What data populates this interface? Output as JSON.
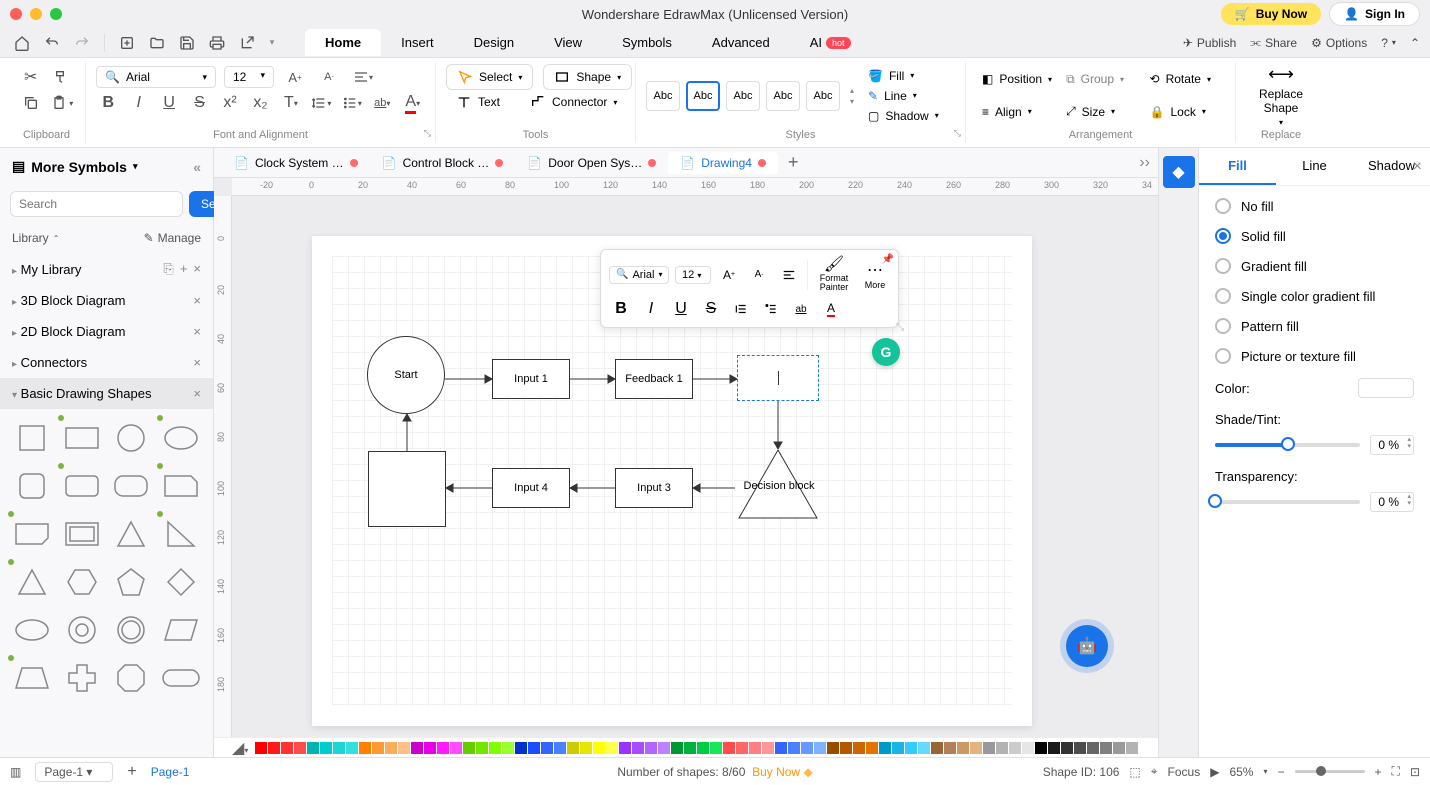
{
  "window": {
    "title": "Wondershare EdrawMax (Unlicensed Version)"
  },
  "titlebar": {
    "buy_now": "Buy Now",
    "sign_in": "Sign In"
  },
  "menu": {
    "tabs": [
      "Home",
      "Insert",
      "Design",
      "View",
      "Symbols",
      "Advanced"
    ],
    "active": 0,
    "ai_label": "AI",
    "hot_label": "hot",
    "publish": "Publish",
    "share": "Share",
    "options": "Options"
  },
  "ribbon": {
    "clipboard_label": "Clipboard",
    "font_label": "Font and Alignment",
    "tools_label": "Tools",
    "styles_label": "Styles",
    "arrangement_label": "Arrangement",
    "replace_label": "Replace",
    "font_name": "Arial",
    "font_size": "12",
    "select_label": "Select",
    "shape_label": "Shape",
    "text_label": "Text",
    "connector_label": "Connector",
    "style_samples": [
      "Abc",
      "Abc",
      "Abc",
      "Abc",
      "Abc"
    ],
    "fill": "Fill",
    "line": "Line",
    "shadow": "Shadow",
    "position": "Position",
    "group": "Group",
    "rotate": "Rotate",
    "align": "Align",
    "size": "Size",
    "lock": "Lock",
    "replace_shape": "Replace\nShape",
    "replace": "Replace"
  },
  "sidebar": {
    "title": "More Symbols",
    "search_placeholder": "Search",
    "search_btn": "Search",
    "library_label": "Library",
    "manage_label": "Manage",
    "categories": [
      {
        "name": "My Library",
        "buttons": true
      },
      {
        "name": "3D Block Diagram",
        "close": true
      },
      {
        "name": "2D Block Diagram",
        "close": true
      },
      {
        "name": "Connectors",
        "close": true
      },
      {
        "name": "Basic Drawing Shapes",
        "close": true,
        "active": true
      }
    ]
  },
  "docs": {
    "tabs": [
      {
        "name": "Clock System …",
        "unsaved": true
      },
      {
        "name": "Control Block …",
        "unsaved": true
      },
      {
        "name": "Door Open Sys…",
        "unsaved": true
      },
      {
        "name": "Drawing4",
        "unsaved": true,
        "active": true
      }
    ]
  },
  "ruler": {
    "h": [
      "-20",
      "0",
      "20",
      "40",
      "60",
      "80",
      "100",
      "120",
      "140",
      "160",
      "180",
      "200",
      "220",
      "240",
      "260",
      "280",
      "300",
      "320",
      "34"
    ],
    "v": [
      "0",
      "20",
      "40",
      "60",
      "80",
      "100",
      "120",
      "140",
      "160",
      "180"
    ]
  },
  "canvas": {
    "start": "Start",
    "input1": "Input 1",
    "feedback1": "Feedback 1",
    "input4": "Input 4",
    "input3": "Input 3",
    "decision": "Decision block"
  },
  "mini_toolbar": {
    "font": "Arial",
    "size": "12",
    "format_painter": "Format\nPainter",
    "more": "More"
  },
  "right_panel": {
    "tabs": [
      "Fill",
      "Line",
      "Shadow"
    ],
    "active": 0,
    "options": [
      "No fill",
      "Solid fill",
      "Gradient fill",
      "Single color gradient fill",
      "Pattern fill",
      "Picture or texture fill"
    ],
    "selected": 1,
    "color_label": "Color:",
    "shade_label": "Shade/Tint:",
    "transparency_label": "Transparency:",
    "shade_val": "0 %",
    "transparency_val": "0 %"
  },
  "palette": [
    "#ff0000",
    "#ff1a1a",
    "#ff3333",
    "#ff4d4d",
    "#00b3b3",
    "#00cccc",
    "#1ad6d6",
    "#33e0e0",
    "#ff8000",
    "#ff9933",
    "#ffad5c",
    "#ffc085",
    "#cc00cc",
    "#e600e6",
    "#ff1aff",
    "#ff4dff",
    "#66cc00",
    "#73e600",
    "#80ff00",
    "#99ff33",
    "#0033cc",
    "#1a4dff",
    "#3366ff",
    "#4d80ff",
    "#cccc00",
    "#e6e600",
    "#ffff00",
    "#ffff4d",
    "#9933ff",
    "#a64dff",
    "#b366ff",
    "#c080ff",
    "#009933",
    "#00b33c",
    "#00cc44",
    "#1ae65c",
    "#ff4d4d",
    "#ff6666",
    "#ff8080",
    "#ff9999",
    "#3366ff",
    "#4d80ff",
    "#6699ff",
    "#80b3ff",
    "#994d00",
    "#b35900",
    "#cc6600",
    "#e67300",
    "#0099cc",
    "#1ab3e6",
    "#33ccff",
    "#66d9ff",
    "#996633",
    "#b38059",
    "#cc9966",
    "#e6b380",
    "#999999",
    "#b3b3b3",
    "#cccccc",
    "#e6e6e6",
    "#000000",
    "#1a1a1a",
    "#333333",
    "#4d4d4d",
    "#666666",
    "#808080",
    "#999999",
    "#b3b3b3"
  ],
  "status": {
    "page_select": "Page-1",
    "page_tab": "Page-1",
    "shapes_count": "Number of shapes: 8/60",
    "buy_now": "Buy Now",
    "shape_id": "Shape ID: 106",
    "focus": "Focus",
    "zoom": "65%"
  }
}
